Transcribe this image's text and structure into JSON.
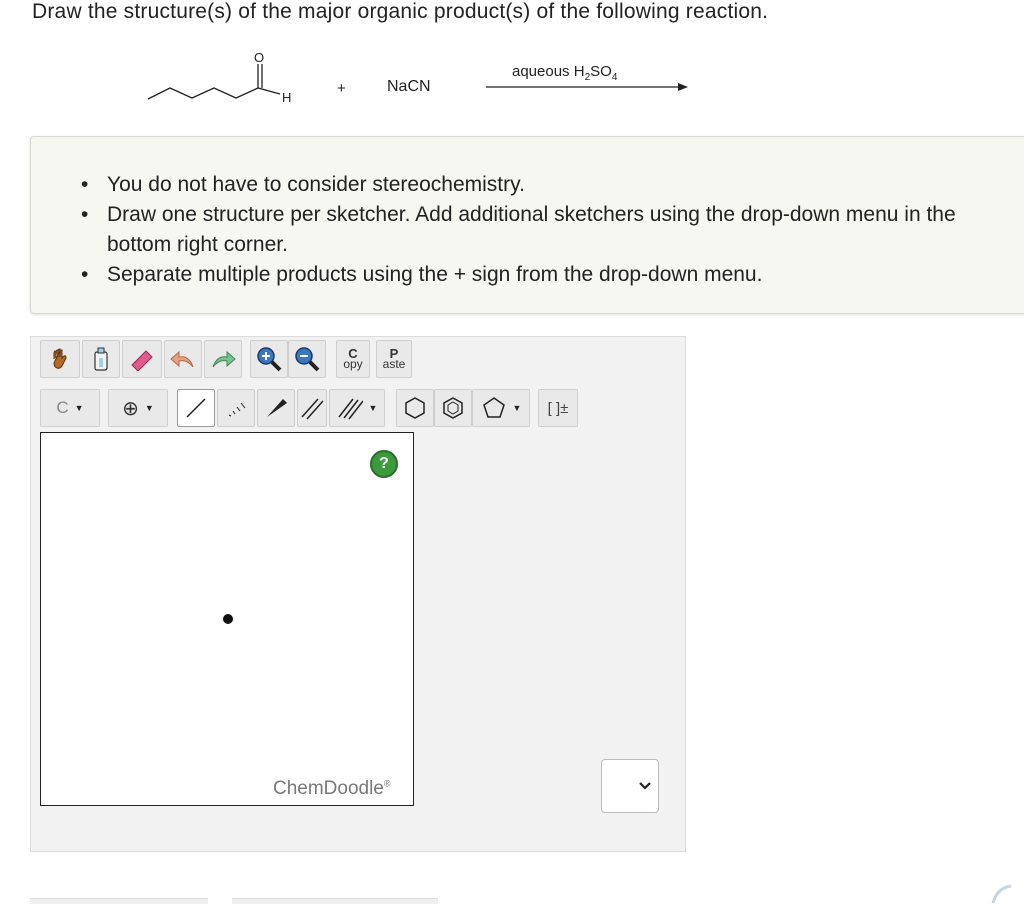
{
  "question": {
    "title": "Draw the structure(s) of the major organic product(s) of the following reaction."
  },
  "reaction": {
    "reactant_atoms": {
      "oxygen": "O",
      "hydrogen": "H"
    },
    "plus": "+",
    "reagent": "NaCN",
    "condition_prefix": "aqueous H",
    "condition_sub1": "2",
    "condition_mid": "SO",
    "condition_sub2": "4"
  },
  "instructions": {
    "items": [
      "You do not have to consider stereochemistry.",
      "Draw one structure per sketcher. Add additional sketchers using the drop-down menu in the bottom right corner.",
      "Separate multiple products using the + sign from the drop-down menu."
    ]
  },
  "toolbar": {
    "row1": [
      {
        "name": "hand-tool-icon"
      },
      {
        "name": "clear-canvas-icon"
      },
      {
        "name": "eraser-icon"
      },
      {
        "name": "undo-icon"
      },
      {
        "name": "redo-icon"
      },
      {
        "name": "zoom-in-icon"
      },
      {
        "name": "zoom-out-icon"
      }
    ],
    "copy": {
      "big": "C",
      "small": "opy"
    },
    "paste": {
      "big": "P",
      "small": "aste"
    },
    "atom_label": "C",
    "charge_symbol": "⊕",
    "bracket_label": "[ ]±"
  },
  "sketcher": {
    "help_label": "?",
    "brand": "ChemDoodle",
    "brand_mark": "®"
  },
  "colors": {
    "info_bg": "#f7f7f2",
    "panel_bg": "#f2f2f2",
    "help_green": "#3c9a3c",
    "eraser_pink": "#e05a8a",
    "undo_salmon": "#e8a080",
    "redo_green": "#7cc090"
  }
}
